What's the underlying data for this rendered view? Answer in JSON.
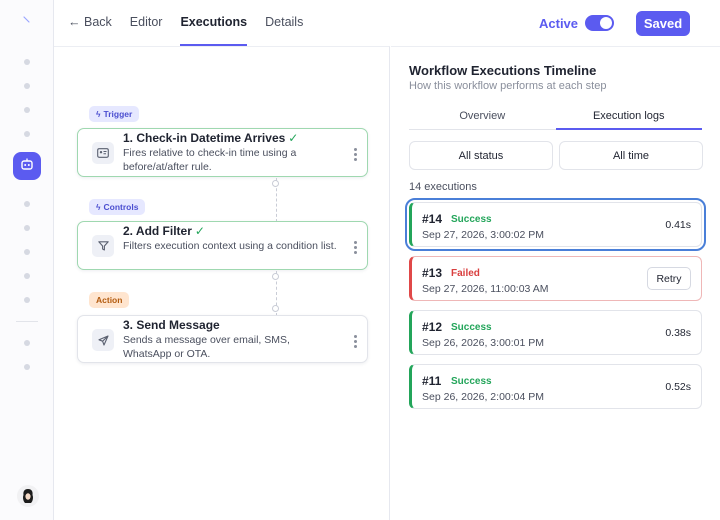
{
  "header": {
    "back_label": "Back",
    "tabs": [
      "Editor",
      "Executions",
      "Details"
    ],
    "active_tab": "Executions",
    "status_label": "Active",
    "saved_label": "Saved",
    "accent_color": "#5b5bf0"
  },
  "workflow": {
    "nodes": [
      {
        "badge": "Trigger",
        "badge_icon": "bolt-icon",
        "title": "1. Check-in Datetime Arrives",
        "completed": true,
        "description": "Fires relative to check-in time using a before/at/after rule.",
        "icon": "id-card-icon"
      },
      {
        "badge": "Controls",
        "badge_icon": "bolt-icon",
        "title": "2. Add Filter",
        "completed": true,
        "description": "Filters execution context using a condition list.",
        "icon": "filter-icon"
      },
      {
        "badge": "Action",
        "title": "3. Send Message",
        "completed": false,
        "description": "Sends a message over email, SMS, WhatsApp or OTA.",
        "icon": "send-icon"
      }
    ],
    "check_mark": "✓"
  },
  "timeline": {
    "title": "Workflow Executions Timeline",
    "subtitle": "How this workflow performs at each step",
    "tabs": [
      "Overview",
      "Execution logs"
    ],
    "active_tab": "Execution logs",
    "filter_status": "All status",
    "filter_time": "All time",
    "count_label": "14 executions",
    "executions": [
      {
        "id": "#14",
        "status": "Success",
        "timestamp": "Sep 27, 2026, 3:00:02 PM",
        "duration": "0.41s",
        "selected": true
      },
      {
        "id": "#13",
        "status": "Failed",
        "timestamp": "Sep 27, 2026, 11:00:03 AM",
        "action": "Retry"
      },
      {
        "id": "#12",
        "status": "Success",
        "timestamp": "Sep 26, 2026, 3:00:01 PM",
        "duration": "0.38s"
      },
      {
        "id": "#11",
        "status": "Success",
        "timestamp": "Sep 26, 2026, 2:00:04 PM",
        "duration": "0.52s"
      }
    ],
    "colors": {
      "success": "#23a55a",
      "failed": "#d93e3e",
      "selected_outline": "#4a7fd8"
    }
  }
}
